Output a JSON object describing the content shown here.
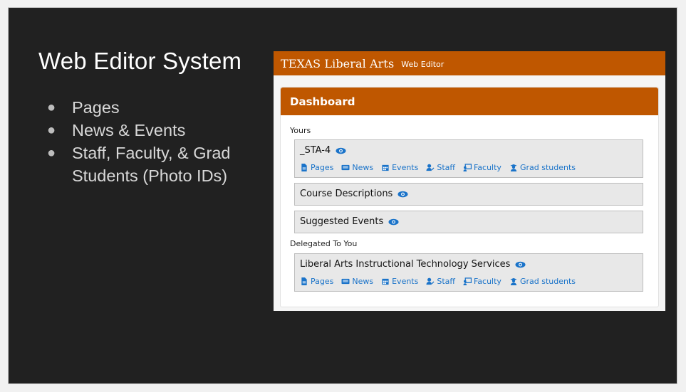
{
  "slide": {
    "title": "Web Editor System",
    "bullets": [
      "Pages",
      "News & Events",
      "Staff, Faculty, & Grad Students (Photo IDs)"
    ]
  },
  "app": {
    "brand": "TEXAS Liberal Arts",
    "subtitle": "Web Editor",
    "accent_color": "#bf5700",
    "link_color": "#1a73c9",
    "dashboard": {
      "title": "Dashboard",
      "yours_label": "Yours",
      "delegated_label": "Delegated To You",
      "sites": [
        {
          "name": "_STA-4",
          "icon": "eye-icon",
          "links": [
            "Pages",
            "News",
            "Events",
            "Staff",
            "Faculty",
            "Grad students"
          ]
        },
        {
          "name": "Course Descriptions",
          "icon": "eye-icon"
        },
        {
          "name": "Suggested Events",
          "icon": "eye-icon"
        },
        {
          "name": "Liberal Arts Instructional Technology Services",
          "icon": "eye-icon",
          "links": [
            "Pages",
            "News",
            "Events",
            "Staff",
            "Faculty",
            "Grad students"
          ]
        }
      ],
      "link_icons": [
        "file-icon",
        "newspaper-icon",
        "calendar-icon",
        "user-edit-icon",
        "chalkboard-teacher-icon",
        "graduate-icon"
      ]
    }
  }
}
